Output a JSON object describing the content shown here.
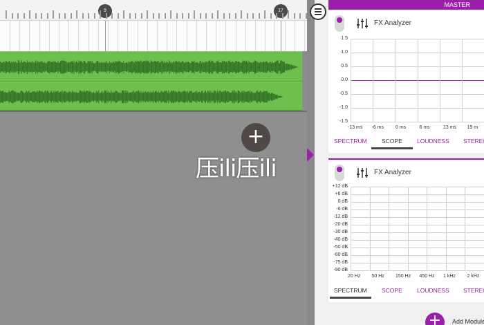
{
  "ruler": {
    "markers": [
      "9",
      "17"
    ]
  },
  "watermark": "压ili压ili",
  "add_track_glyph": "+",
  "master": {
    "label": "MASTER"
  },
  "modules": [
    {
      "title": "FX Analyzer",
      "y_labels": [
        "1.5",
        "1.0",
        "0.5",
        "0.0",
        "-0.5",
        "-1.0",
        "-1.5"
      ],
      "x_labels": [
        "-13 ms",
        "-6 ms",
        "0 ms",
        "6 ms",
        "13 ms",
        "19 m"
      ],
      "tabs": [
        "SPECTRUM",
        "SCOPE",
        "LOUDNESS",
        "STEREO"
      ],
      "active_tab": "SCOPE"
    },
    {
      "title": "FX Analyzer",
      "y_labels": [
        "+12 dB",
        "+6 dB",
        "0 dB",
        "-6 dB",
        "-12 dB",
        "-20 dB",
        "-30 dB",
        "-40 dB",
        "-50 dB",
        "-60 dB",
        "-75 dB",
        "-90 dB"
      ],
      "x_labels": [
        "20 Hz",
        "50 Hz",
        "150 Hz",
        "450 Hz",
        "1 kHz",
        "2 kHz"
      ],
      "tabs": [
        "SPECTRUM",
        "SCOPE",
        "LOUDNESS",
        "STEREO"
      ],
      "active_tab": "SPECTRUM"
    }
  ],
  "add_module": {
    "glyph": "+",
    "label": "Add Module"
  },
  "colors": {
    "accent": "#9b1fa8",
    "track": "#6fbf4f",
    "waveform": "#2f6e23"
  },
  "icons": {
    "menu": "menu-icon",
    "fx": "equalizer-icon",
    "collapse": "collapse-arrow-icon"
  }
}
